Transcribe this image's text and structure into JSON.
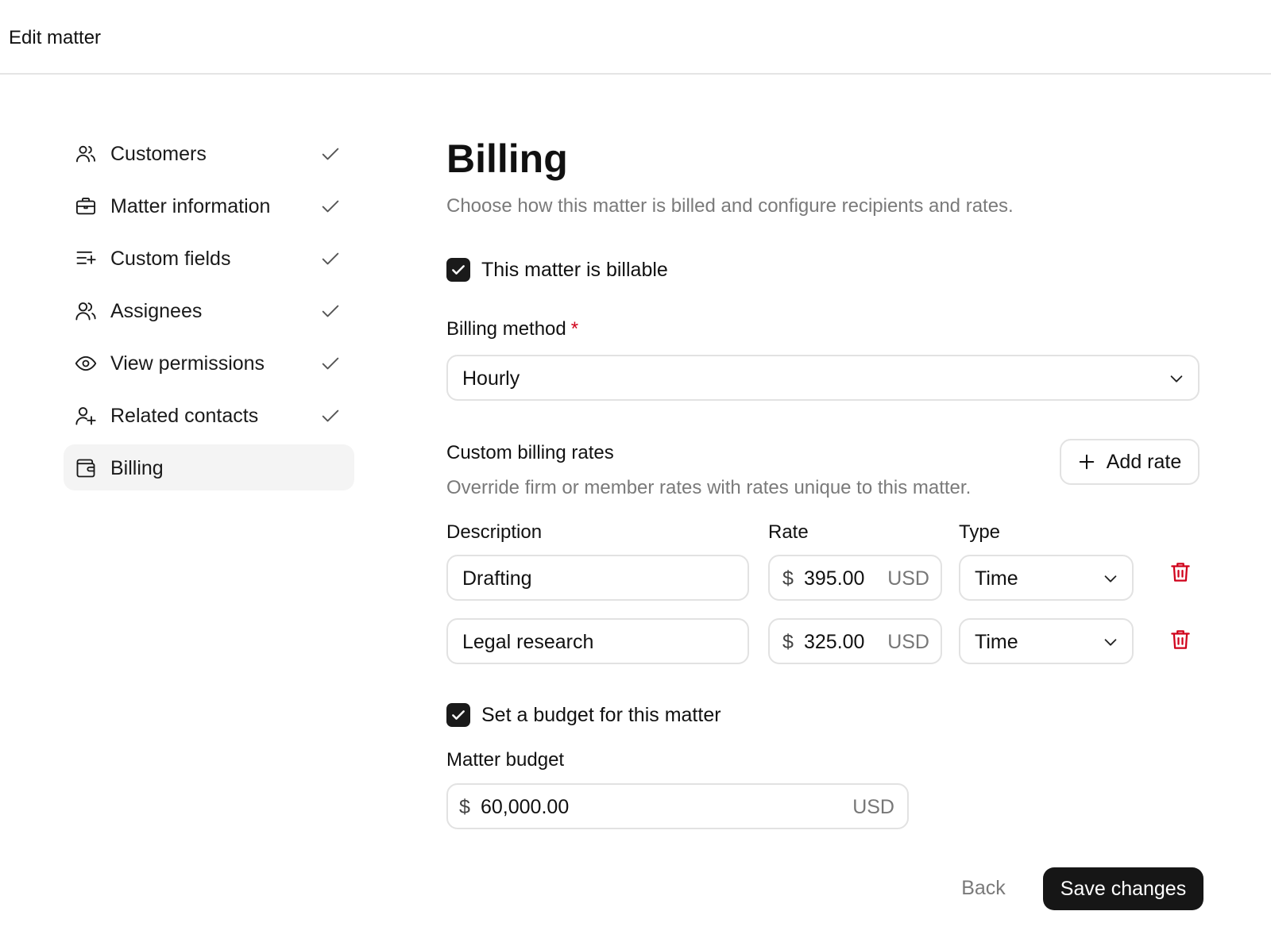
{
  "header": {
    "title": "Edit matter"
  },
  "sidebar": {
    "items": [
      {
        "label": "Customers",
        "icon": "users-icon",
        "completed": true,
        "active": false
      },
      {
        "label": "Matter information",
        "icon": "briefcase-icon",
        "completed": true,
        "active": false
      },
      {
        "label": "Custom fields",
        "icon": "list-plus-icon",
        "completed": true,
        "active": false
      },
      {
        "label": "Assignees",
        "icon": "user-group-icon",
        "completed": true,
        "active": false
      },
      {
        "label": "View permissions",
        "icon": "eye-icon",
        "completed": true,
        "active": false
      },
      {
        "label": "Related contacts",
        "icon": "user-plus-icon",
        "completed": true,
        "active": false
      },
      {
        "label": "Billing",
        "icon": "wallet-icon",
        "completed": false,
        "active": true
      }
    ]
  },
  "main": {
    "title": "Billing",
    "subtitle": "Choose how this matter is billed and configure recipients and rates.",
    "billable": {
      "label": "This matter is billable",
      "checked": true
    },
    "billing_method": {
      "label": "Billing method",
      "required_mark": "*",
      "value": "Hourly"
    },
    "custom_rates": {
      "title": "Custom billing rates",
      "subtitle": "Override firm or member rates with rates unique to this matter.",
      "add_label": "Add rate",
      "columns": {
        "description": "Description",
        "rate": "Rate",
        "type": "Type"
      },
      "rows": [
        {
          "description": "Drafting",
          "currency_symbol": "$",
          "rate": "395.00",
          "currency": "USD",
          "type": "Time"
        },
        {
          "description": "Legal research",
          "currency_symbol": "$",
          "rate": "325.00",
          "currency": "USD",
          "type": "Time"
        }
      ]
    },
    "budget": {
      "checkbox_label": "Set a budget for this matter",
      "checked": true,
      "label": "Matter budget",
      "currency_symbol": "$",
      "value": "60,000.00",
      "currency": "USD"
    },
    "actions": {
      "back": "Back",
      "save": "Save changes"
    }
  },
  "colors": {
    "primary": "#161616",
    "danger": "#d0021b",
    "muted": "#7a7a7a",
    "border": "#e2e2e2"
  }
}
